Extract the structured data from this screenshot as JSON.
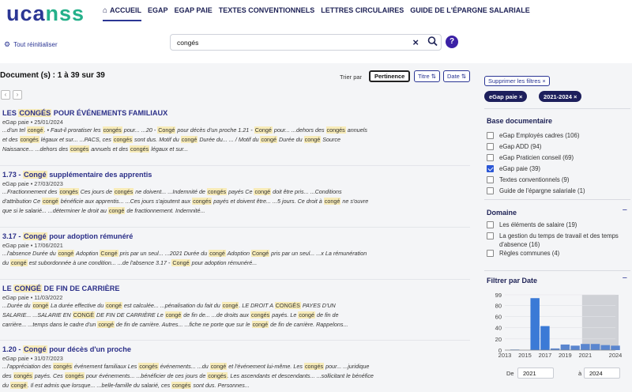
{
  "header": {
    "logo_part1": "uca",
    "logo_part2": "nss",
    "nav": [
      "ACCUEIL",
      "EGAP",
      "EGAP PAIE",
      "TEXTES CONVENTIONNELS",
      "LETTRES CIRCULAIRES",
      "GUIDE DE L'ÉPARGNE SALARIALE"
    ]
  },
  "search": {
    "reset_label": "Tout réinitialiser",
    "query": "congés",
    "clear_symbol": "×",
    "help_symbol": "?"
  },
  "results_header": {
    "count": "Document (s) : 1 à 39 sur 39",
    "sort_label": "Trier par",
    "sort_options": [
      "Pertinence",
      "Titre ⇅",
      "Date ⇅"
    ],
    "pagination": [
      "‹",
      "›"
    ]
  },
  "results": [
    {
      "title_parts": [
        {
          "t": "LES "
        },
        {
          "t": "CONGÉS",
          "hl": true
        },
        {
          "t": " POUR ÉVÉNEMENTS FAMILIAUX"
        }
      ],
      "meta": "eGap paie • 25/01/2024",
      "snippet": [
        [
          {
            "t": "...d'un tel "
          },
          {
            "t": "congé",
            "hl": true
          },
          {
            "t": ". • Faut-il proratiser les "
          },
          {
            "t": "congés",
            "hl": true
          },
          {
            "t": " pour...      ...20 - "
          },
          {
            "t": "Congé",
            "hl": true
          },
          {
            "t": " pour décès d'un proche 1.21 - "
          },
          {
            "t": "Congé",
            "hl": true
          },
          {
            "t": " pour...      ...dehors des "
          },
          {
            "t": "congés",
            "hl": true
          },
          {
            "t": " annuels"
          }
        ],
        [
          {
            "t": "et des "
          },
          {
            "t": "congés",
            "hl": true
          },
          {
            "t": " légaux et sur...      ...PACS, ces "
          },
          {
            "t": "congés",
            "hl": true
          },
          {
            "t": " sont dus. Motif du "
          },
          {
            "t": "congé",
            "hl": true
          },
          {
            "t": " Durée du...      ... / Motif du "
          },
          {
            "t": "congé",
            "hl": true
          },
          {
            "t": " Durée du "
          },
          {
            "t": "congé",
            "hl": true
          },
          {
            "t": " Source"
          }
        ],
        [
          {
            "t": "Naissance...      ...dehors des "
          },
          {
            "t": "congés",
            "hl": true
          },
          {
            "t": " annuels et des "
          },
          {
            "t": "congés",
            "hl": true
          },
          {
            "t": " légaux et sur..."
          }
        ]
      ]
    },
    {
      "title_parts": [
        {
          "t": "1.73 - "
        },
        {
          "t": "Congé",
          "hl": true
        },
        {
          "t": " supplémentaire des apprentis"
        }
      ],
      "meta": "eGap paie • 27/03/2023",
      "snippet": [
        [
          {
            "t": "...Fractionnement des "
          },
          {
            "t": "congés",
            "hl": true
          },
          {
            "t": " Ces jours de "
          },
          {
            "t": "congés",
            "hl": true
          },
          {
            "t": " ne doivent...      ...Indemnité de "
          },
          {
            "t": "congés",
            "hl": true
          },
          {
            "t": " payés Ce "
          },
          {
            "t": "congé",
            "hl": true
          },
          {
            "t": " doit être pris...      ...Conditions"
          }
        ],
        [
          {
            "t": "d'attribution Ce "
          },
          {
            "t": "congé",
            "hl": true
          },
          {
            "t": " bénéficie aux apprentis...      ...Ces jours s'ajoutent aux "
          },
          {
            "t": "congés",
            "hl": true
          },
          {
            "t": " payés et doivent être...      ...5 jours. Ce droit à "
          },
          {
            "t": "congé",
            "hl": true
          },
          {
            "t": " ne s'ouvre"
          }
        ],
        [
          {
            "t": "que si le salarié...      ...déterminer le droit au "
          },
          {
            "t": "congé",
            "hl": true
          },
          {
            "t": " de fractionnement. Indemnité..."
          }
        ]
      ]
    },
    {
      "title_parts": [
        {
          "t": "3.17 - "
        },
        {
          "t": "Congé",
          "hl": true
        },
        {
          "t": " pour adoption rémunéré"
        }
      ],
      "meta": "eGap paie • 17/06/2021",
      "snippet": [
        [
          {
            "t": "...l'absence Durée du "
          },
          {
            "t": "congé",
            "hl": true
          },
          {
            "t": " Adoption "
          },
          {
            "t": "Congé",
            "hl": true
          },
          {
            "t": " pris par un seul...      ...2021 Durée du "
          },
          {
            "t": "congé",
            "hl": true
          },
          {
            "t": " Adoption "
          },
          {
            "t": "Congé",
            "hl": true
          },
          {
            "t": " pris par un seul...      ...x La rémunération"
          }
        ],
        [
          {
            "t": "du "
          },
          {
            "t": "congé",
            "hl": true
          },
          {
            "t": " est subordonnée à une condition...      ...de l'absence 3.17 - "
          },
          {
            "t": "Congé",
            "hl": true
          },
          {
            "t": " pour adoption rémunéré..."
          }
        ]
      ]
    },
    {
      "title_parts": [
        {
          "t": "LE "
        },
        {
          "t": "CONGÉ",
          "hl": true
        },
        {
          "t": " DE FIN DE CARRIÈRE"
        }
      ],
      "meta": "eGap paie • 11/03/2022",
      "snippet": [
        [
          {
            "t": "...Durée du "
          },
          {
            "t": "congé",
            "hl": true
          },
          {
            "t": " La durée effective du "
          },
          {
            "t": "congé",
            "hl": true
          },
          {
            "t": " est calculée...      ...pénalisation du fait du "
          },
          {
            "t": "congé",
            "hl": true
          },
          {
            "t": ". LE DROIT A "
          },
          {
            "t": "CONGÉS",
            "hl": true
          },
          {
            "t": " PAYES D'UN"
          }
        ],
        [
          {
            "t": "SALARIE...      ...SALARIE EN "
          },
          {
            "t": "CONGÉ",
            "hl": true
          },
          {
            "t": " DE FIN DE CARRIÈRE Le "
          },
          {
            "t": "congé",
            "hl": true
          },
          {
            "t": " de fin de...      ...de droits aux "
          },
          {
            "t": "congés",
            "hl": true
          },
          {
            "t": " payés. Le "
          },
          {
            "t": "congé",
            "hl": true
          },
          {
            "t": " de fin de"
          }
        ],
        [
          {
            "t": "carrière...      ...temps dans le cadre d'un "
          },
          {
            "t": "congé",
            "hl": true
          },
          {
            "t": " de fin de carrière. Autres...      ...fiche ne porte que sur le "
          },
          {
            "t": "congé",
            "hl": true
          },
          {
            "t": " de fin de carrière. Rappelons..."
          }
        ]
      ]
    },
    {
      "title_parts": [
        {
          "t": "1.20 - "
        },
        {
          "t": "Congé",
          "hl": true
        },
        {
          "t": " pour décès d'un proche"
        }
      ],
      "meta": "eGap paie • 31/07/2023",
      "snippet": [
        [
          {
            "t": "...l'appréciation des "
          },
          {
            "t": "congés",
            "hl": true
          },
          {
            "t": " événement familiaux Les "
          },
          {
            "t": "congés",
            "hl": true
          },
          {
            "t": " événements...      ...du "
          },
          {
            "t": "congé",
            "hl": true
          },
          {
            "t": " et l'événement lui-même. Les "
          },
          {
            "t": "congés",
            "hl": true
          },
          {
            "t": " pour...      ...juridique"
          }
        ],
        [
          {
            "t": "des "
          },
          {
            "t": "congés",
            "hl": true
          },
          {
            "t": " payés. Ces "
          },
          {
            "t": "congés",
            "hl": true
          },
          {
            "t": " pour événements...      ...bénéficier de ces jours de "
          },
          {
            "t": "congés",
            "hl": true
          },
          {
            "t": ". Les ascendants et descendants...      ...sollicitant le bénéfice"
          }
        ],
        [
          {
            "t": "du "
          },
          {
            "t": "congé",
            "hl": true
          },
          {
            "t": ". Il est admis que lorsque...      ...belle-famille du salarié, ces "
          },
          {
            "t": "congés",
            "hl": true
          },
          {
            "t": " sont dus. Personnes..."
          }
        ]
      ]
    }
  ],
  "filters": {
    "clear_label": "Supprimer les filtres",
    "active_chips": [
      "eGap paie",
      "2021-2024"
    ],
    "base_title": "Base documentaire",
    "base_items": [
      {
        "label": "eGap Employés cadres (106)",
        "checked": false
      },
      {
        "label": "eGap ADD (94)",
        "checked": false
      },
      {
        "label": "eGap Praticien conseil (69)",
        "checked": false
      },
      {
        "label": "eGap paie (39)",
        "checked": true
      },
      {
        "label": "Textes conventionnels (9)",
        "checked": false
      },
      {
        "label": "Guide de l'épargne salariale (1)",
        "checked": false
      }
    ],
    "domain_title": "Domaine",
    "domain_items": [
      {
        "label": "Les éléments de salaire (19)",
        "checked": false
      },
      {
        "label": "La gestion du temps de travail et des temps d'absence (16)",
        "checked": false
      },
      {
        "label": "Règles communes (4)",
        "checked": false
      }
    ],
    "date_title": "Filtrer par Date",
    "date_from_label": "De",
    "date_from": "2021",
    "date_to_label": "à",
    "date_to": "2024"
  },
  "colors": {
    "accent": "#2b3694",
    "brand_green": "#25b08a",
    "highlight": "#f7ebb8",
    "bar": "#4a7fd0"
  },
  "chart_data": {
    "type": "bar",
    "x": [
      2013,
      2014,
      2015,
      2016,
      2017,
      2018,
      2019,
      2020,
      2021,
      2022,
      2023,
      2024
    ],
    "values": [
      0,
      1,
      0,
      93,
      43,
      3,
      10,
      8,
      11,
      11,
      9,
      8
    ],
    "xticks": [
      "2013",
      "2015",
      "2017",
      "2019",
      "2021",
      "2024"
    ],
    "yticks": [
      "0",
      "20",
      "40",
      "60",
      "80",
      "99"
    ],
    "ylim": [
      0,
      99
    ],
    "selected_range": [
      2021,
      2024
    ]
  }
}
